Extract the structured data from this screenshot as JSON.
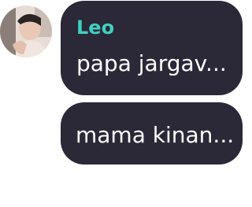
{
  "contact": {
    "name": "Leo",
    "avatar_icon": "profile-photo",
    "name_color": "#3fd0c0"
  },
  "messages": [
    {
      "text": "papa jargav..."
    },
    {
      "text": "mama kinan..."
    }
  ],
  "theme": {
    "bubble_color": "#2b2838",
    "text_color": "#ffffff",
    "background": "#ffffff"
  }
}
